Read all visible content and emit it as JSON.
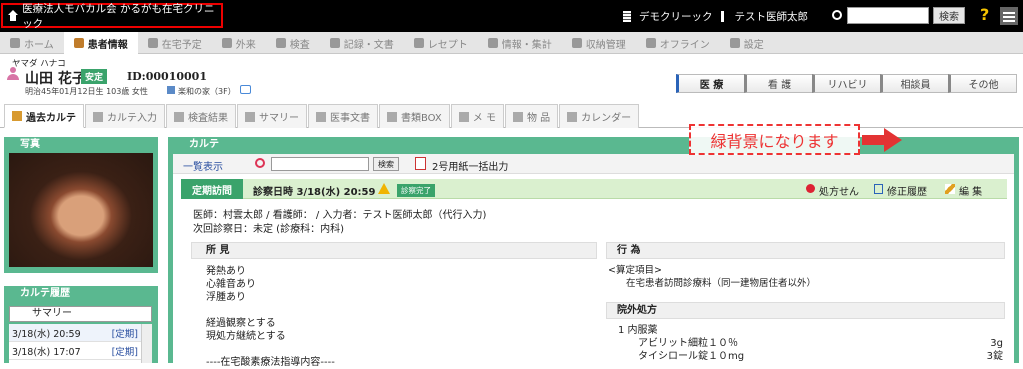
{
  "topbar": {
    "clinic_name": "医療法人モバカル会 かるがも在宅クリニック",
    "facility": "デモクリーック",
    "user": "テスト医師太郎",
    "search_button": "検索",
    "help": "?"
  },
  "nav": {
    "items": [
      {
        "label": "ホーム"
      },
      {
        "label": "患者情報"
      },
      {
        "label": "在宅予定"
      },
      {
        "label": "外来"
      },
      {
        "label": "検査"
      },
      {
        "label": "記録・文書"
      },
      {
        "label": "レセプト"
      },
      {
        "label": "情報・集計"
      },
      {
        "label": "収納管理"
      },
      {
        "label": "オフライン"
      },
      {
        "label": "設定"
      }
    ]
  },
  "patient": {
    "kana": "ヤマダ ハナコ",
    "name": "山田 花子",
    "status_badge": "安定",
    "id": "ID:00010001",
    "birth": "明治45年01月12日生 103歳  女性",
    "room": "楽和の家（3F）"
  },
  "dept_tabs": [
    "医 療",
    "看 護",
    "リハビリ",
    "相談員",
    "その他"
  ],
  "subtabs": [
    "過去カルテ",
    "カルテ入力",
    "検査結果",
    "サマリー",
    "医事文書",
    "書類BOX",
    "メ モ",
    "物 品",
    "カレンダー"
  ],
  "photo_panel": {
    "title": "写真"
  },
  "history_panel": {
    "title": "カルテ履歴",
    "summary_button": "サマリー",
    "rows": [
      {
        "date": "3/18(水) 20:59",
        "type": "[定期]"
      },
      {
        "date": "3/18(水) 17:07",
        "type": "[定期]"
      }
    ]
  },
  "karte": {
    "title": "カルテ",
    "list_button": "一覧表示",
    "search_button": "検索",
    "pdf_button": "2号用紙一括出力",
    "visit_type": "定期訪問",
    "visit_date": "診察日時 3/18(水) 20:59",
    "done_badge": "診察完了",
    "rx_button": "処方せん",
    "history_button": "修正履歴",
    "edit_button": "編 集",
    "doctors_line": "医師：村雲太郎 / 看護師： / 入力者：テスト医師太郎（代行入力)",
    "next_visit": "次回診察日：未定 (診療科：内科)",
    "finding_title": "所 見",
    "findings": "発熱あり\n心雑音あり\n浮腫あり\n\n経過観察とする\n現処方継続とする\n\n----在宅酸素療法指導内容----",
    "action_title": "行 為",
    "action_head": "<算定項目>",
    "action_item": "在宅患者訪問診療料（同一建物居住者以外）",
    "rx_title": "院外処方",
    "rx_group": "1  内服薬",
    "rx_items": [
      {
        "name": "アビリット細粒１０％",
        "qty": "3g"
      },
      {
        "name": "タイシロール錠１０mg",
        "qty": "3錠"
      }
    ]
  },
  "annotation": {
    "text": "緑背景になります"
  },
  "colors": {
    "green": "#5ab890",
    "badge_green": "#3aa36b",
    "annotation_red": "#e33333",
    "topbar": "#000000"
  }
}
